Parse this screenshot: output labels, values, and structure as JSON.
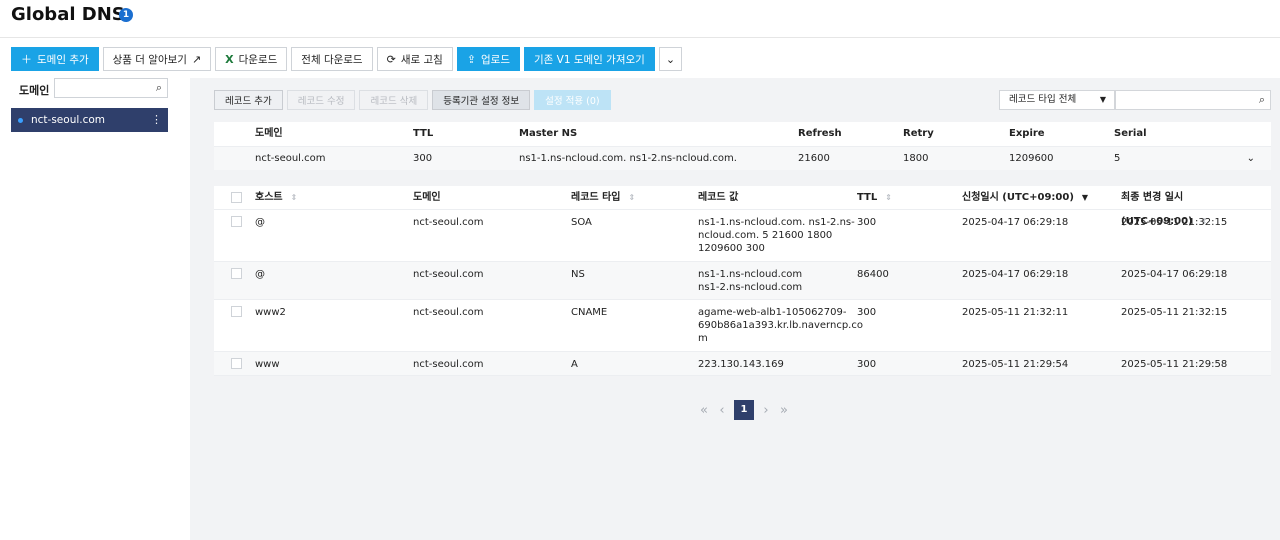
{
  "header": {
    "title": "Global DNS",
    "badge": "1"
  },
  "toolbar": {
    "add_domain": "도메인 추가",
    "learn_more": "상품 더 알아보기",
    "download": "다운로드",
    "download_all": "전체 다운로드",
    "refresh": "새로 고침",
    "upload": "업로드",
    "import_v1": "기존 V1 도메인 가져오기"
  },
  "sidebar": {
    "label": "도메인",
    "search_value": "",
    "items": [
      {
        "name": "nct-seoul.com"
      }
    ]
  },
  "record_actions": {
    "add": "레코드 추가",
    "edit": "레코드 수정",
    "delete": "레코드 삭제",
    "registrar_info": "등록기관 설정 정보",
    "apply": "설정 적용 (0)"
  },
  "filter": {
    "record_type": "레코드 타입 전체",
    "search_value": ""
  },
  "soa": {
    "headers": [
      "도메인",
      "TTL",
      "Master NS",
      "Refresh",
      "Retry",
      "Expire",
      "Serial"
    ],
    "row": {
      "domain": "nct-seoul.com",
      "ttl": "300",
      "master_ns": "ns1-1.ns-ncloud.com. ns1-2.ns-ncloud.com.",
      "refresh": "21600",
      "retry": "1800",
      "expire": "1209600",
      "serial": "5"
    }
  },
  "records": {
    "headers": {
      "host": "호스트",
      "domain": "도메인",
      "type": "레코드 타입",
      "value": "레코드 값",
      "ttl": "TTL",
      "created": "신청일시 (UTC+09:00)",
      "modified": "최종 변경 일시 (UTC+09:00)"
    },
    "rows": [
      {
        "host": "@",
        "domain": "nct-seoul.com",
        "type": "SOA",
        "value": [
          "ns1-1.ns-ncloud.com. ns1-2.ns-",
          "ncloud.com. 5 21600 1800",
          "1209600 300"
        ],
        "ttl": "300",
        "created": "2025-04-17 06:29:18",
        "modified": "2025-05-11 21:32:15"
      },
      {
        "host": "@",
        "domain": "nct-seoul.com",
        "type": "NS",
        "value": [
          "ns1-1.ns-ncloud.com",
          "ns1-2.ns-ncloud.com"
        ],
        "ttl": "86400",
        "created": "2025-04-17 06:29:18",
        "modified": "2025-04-17 06:29:18"
      },
      {
        "host": "www2",
        "domain": "nct-seoul.com",
        "type": "CNAME",
        "value": [
          "agame-web-alb1-105062709-",
          "690b86a1a393.kr.lb.naverncp.co",
          "m"
        ],
        "ttl": "300",
        "created": "2025-05-11 21:32:11",
        "modified": "2025-05-11 21:32:15"
      },
      {
        "host": "www",
        "domain": "nct-seoul.com",
        "type": "A",
        "value": [
          "223.130.143.169"
        ],
        "ttl": "300",
        "created": "2025-05-11 21:29:54",
        "modified": "2025-05-11 21:29:58"
      }
    ]
  },
  "pagination": {
    "current": "1"
  }
}
